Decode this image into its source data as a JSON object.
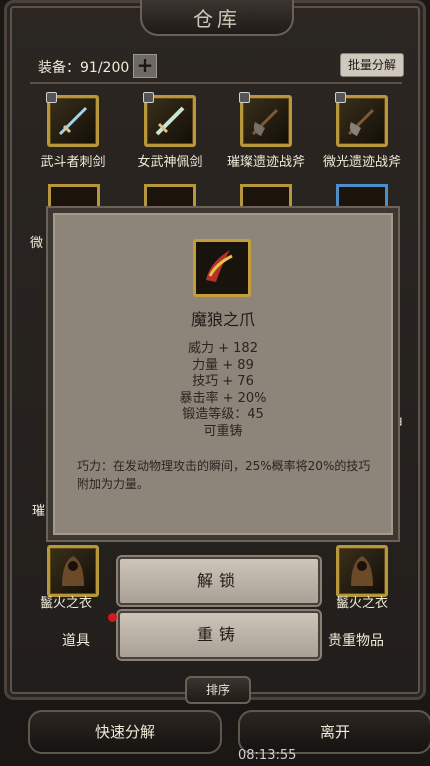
{
  "title": "仓库",
  "inventory": {
    "label": "装备：91/200",
    "add_icon": "plus-icon",
    "batch_label": "批量分解"
  },
  "row1": [
    {
      "name": "武斗者刺剑"
    },
    {
      "name": "女武神佩剑"
    },
    {
      "name": "璀璨遗迹战斧"
    },
    {
      "name": "微光遗迹战斧"
    }
  ],
  "fragments": {
    "left_top": "微",
    "left_mid": "璀",
    "right_mid": "甲"
  },
  "tooltip": {
    "name": "魔狼之爪",
    "stats": [
      "威力 + 182",
      "力量 + 89",
      "技巧 + 76",
      "暴击率 + 20%",
      "锻造等级：45",
      "可重铸"
    ],
    "desc": "巧力：在发动物理攻击的瞬间，25%概率将20%的技巧附加为力量。"
  },
  "actions": {
    "unlock": "解锁",
    "reforge": "重铸"
  },
  "bottom_row": {
    "left": "鬣火之衣",
    "right": "鬣火之衣"
  },
  "tabs": {
    "items": "道具",
    "valuables": "贵重物品"
  },
  "sort_label": "排序",
  "quick_decompose": "快速分解",
  "leave": "离开",
  "clock": "08:13:55",
  "colors": {
    "gold_border": "#b8963a",
    "tooltip_bg": "#8d857a",
    "notify": "#d21a1a"
  }
}
